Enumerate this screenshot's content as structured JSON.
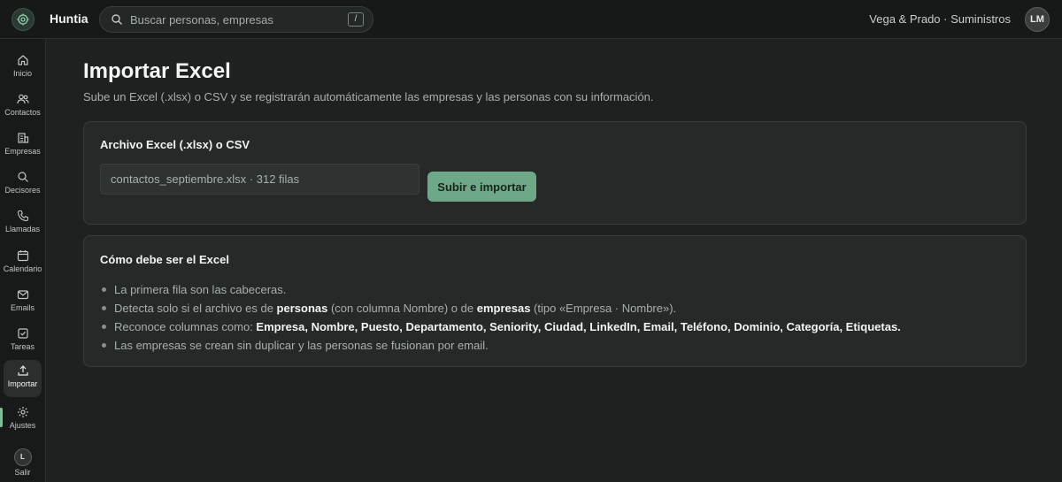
{
  "app": {
    "brand": "Huntia",
    "organization": "Vega & Prado · Suministros",
    "user_initials": "LM"
  },
  "search": {
    "placeholder": "Buscar personas, empresas",
    "shortcut": "/"
  },
  "sidebar": {
    "items": [
      {
        "label": "Inicio",
        "icon": "home-icon"
      },
      {
        "label": "Contactos",
        "icon": "users-icon"
      },
      {
        "label": "Empresas",
        "icon": "building-icon"
      },
      {
        "label": "Decisores",
        "icon": "search-icon"
      },
      {
        "label": "Llamadas",
        "icon": "phone-icon"
      },
      {
        "label": "Calendario",
        "icon": "calendar-icon"
      },
      {
        "label": "Emails",
        "icon": "mail-icon"
      },
      {
        "label": "Tareas",
        "icon": "checkbox-icon"
      },
      {
        "label": "Importar",
        "icon": "upload-icon"
      },
      {
        "label": "Ajustes",
        "icon": "gear-icon"
      }
    ],
    "active": "Importar",
    "logout": {
      "initial": "L",
      "label": "Salir"
    }
  },
  "main": {
    "title": "Importar Excel",
    "subtitle": "Sube un Excel (.xlsx) o CSV y se registrarán automáticamente las empresas y las personas con su información."
  },
  "upload_card": {
    "title": "Archivo Excel (.xlsx) o CSV",
    "file_value": "contactos_septiembre.xlsx · 312 filas",
    "button_label": "Subir e importar"
  },
  "format_card": {
    "title": "Cómo debe ser el Excel",
    "rules": {
      "r1": "La primera fila son las cabeceras.",
      "r2_a": "Detecta solo si el archivo es de ",
      "r2_b": "personas",
      "r2_c": " (con columna Nombre) o de ",
      "r2_d": "empresas",
      "r2_e": " (tipo «Empresa · Nombre»).",
      "r3_a": "Reconoce columnas como: ",
      "r3_b": "Empresa, Nombre, Puesto, Departamento, Seniority, Ciudad, LinkedIn, Email, Teléfono, Dominio, Categoría, Etiquetas.",
      "r4": "Las empresas se crean sin duplicar y las personas se fusionan por email."
    }
  },
  "colors": {
    "accent": "#6fa889",
    "background": "#1e2120",
    "card": "#252928"
  }
}
